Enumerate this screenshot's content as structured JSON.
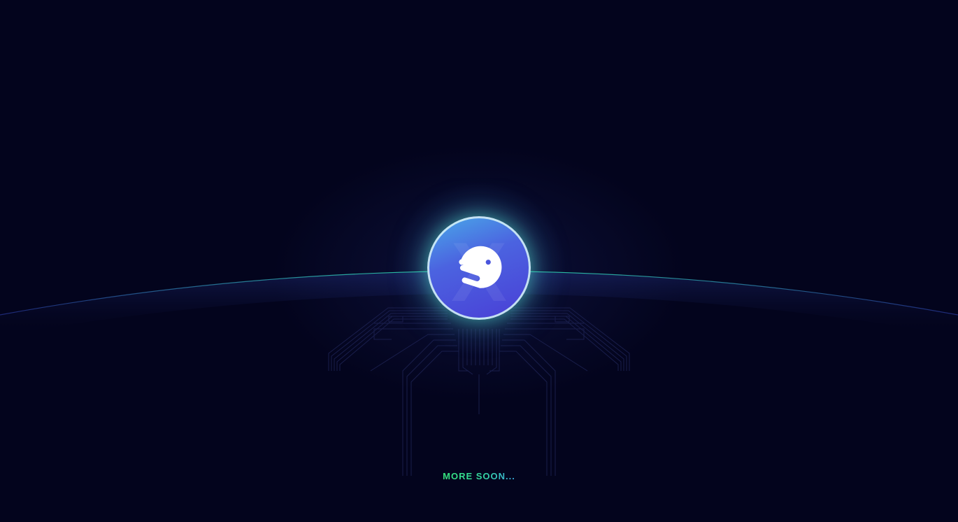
{
  "page": {
    "background_color": "#03041d",
    "accent_color": "#35e37c",
    "secondary_accent_color": "#3fa3e0"
  },
  "logo": {
    "icon": "smiling-moon-icon",
    "badge_gradient": [
      "#4aa8e8",
      "#4a3fd6"
    ],
    "watermark_glyph": "X"
  },
  "footer": {
    "message": "MORE SOON..."
  }
}
